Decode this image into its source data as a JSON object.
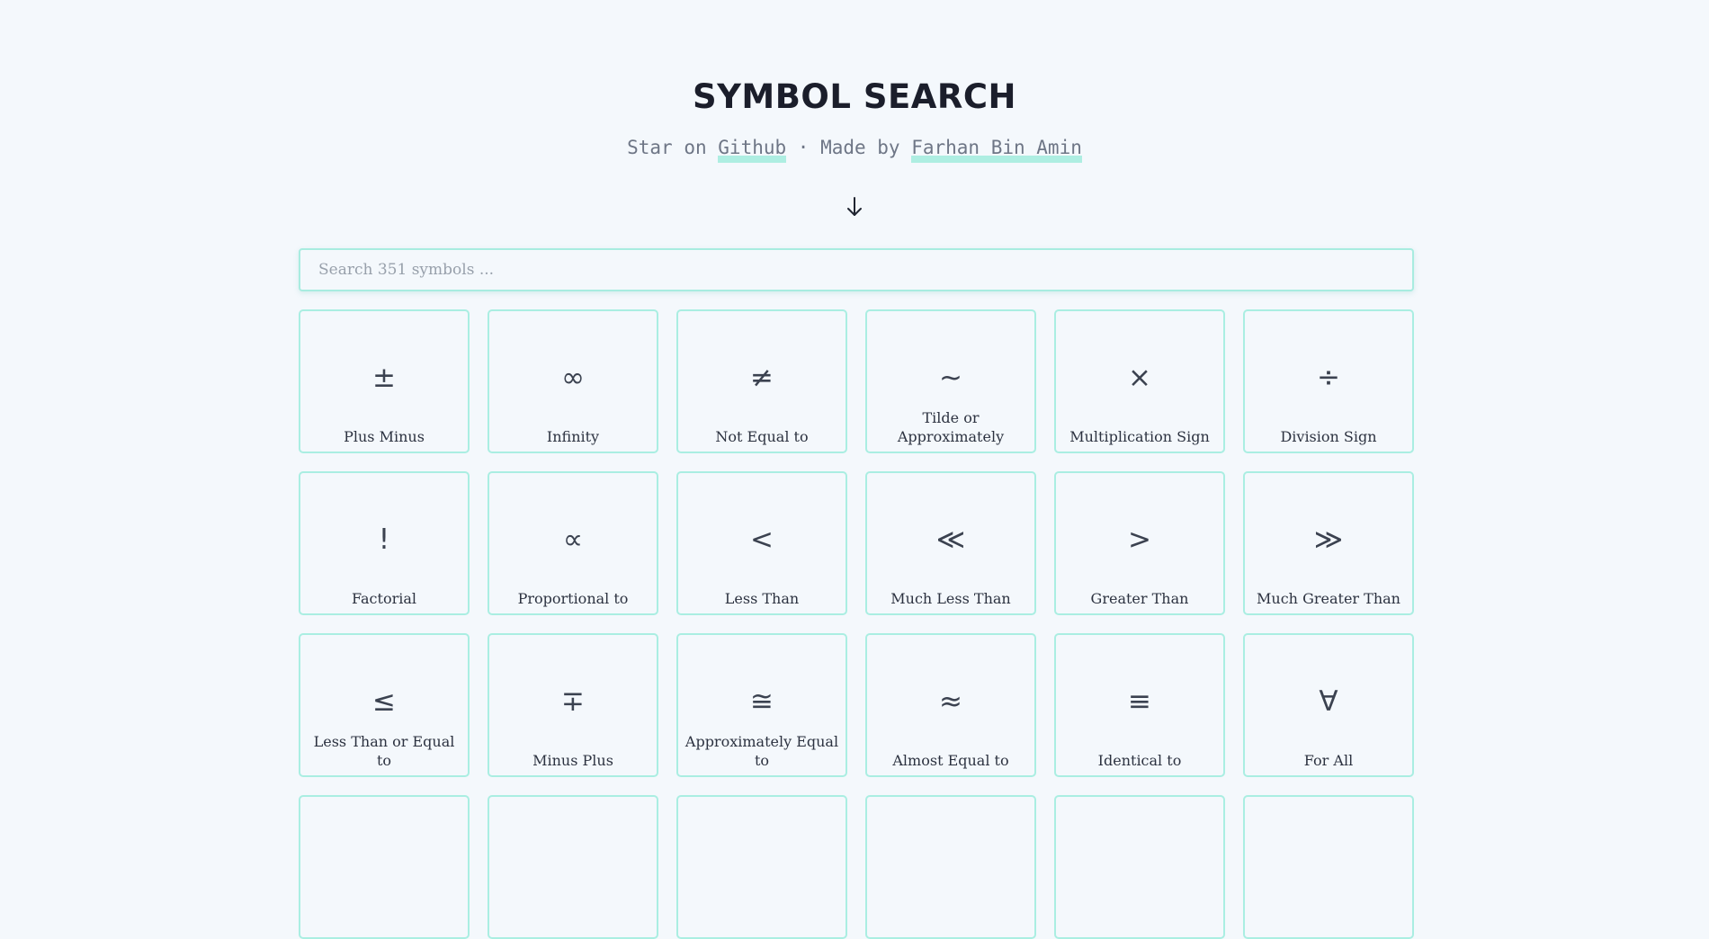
{
  "header": {
    "title": "SYMBOL SEARCH",
    "subtitle_prefix": "Star on ",
    "github_link": "Github",
    "separator": " · Made by ",
    "author_link": "Farhan Bin Amin"
  },
  "search": {
    "placeholder": "Search 351 symbols ...",
    "value": ""
  },
  "icons": {
    "scroll_arrow": "arrow-down-icon"
  },
  "colors": {
    "background": "#f4f8fc",
    "accent": "#aaeee2",
    "title": "#1b1e2b",
    "muted_text": "#6e7686"
  },
  "symbols": [
    {
      "symbol": "±",
      "name": "Plus Minus"
    },
    {
      "symbol": "∞",
      "name": "Infinity"
    },
    {
      "symbol": "≠",
      "name": "Not Equal to"
    },
    {
      "symbol": "~",
      "name": "Tilde or Approximately"
    },
    {
      "symbol": "×",
      "name": "Multiplication Sign"
    },
    {
      "symbol": "÷",
      "name": "Division Sign"
    },
    {
      "symbol": "!",
      "name": "Factorial"
    },
    {
      "symbol": "∝",
      "name": "Proportional to"
    },
    {
      "symbol": "<",
      "name": "Less Than"
    },
    {
      "symbol": "≪",
      "name": "Much Less Than"
    },
    {
      "symbol": ">",
      "name": "Greater Than"
    },
    {
      "symbol": "≫",
      "name": "Much Greater Than"
    },
    {
      "symbol": "≤",
      "name": "Less Than or Equal to"
    },
    {
      "symbol": "∓",
      "name": "Minus Plus"
    },
    {
      "symbol": "≅",
      "name": "Approximately Equal to"
    },
    {
      "symbol": "≈",
      "name": "Almost Equal to"
    },
    {
      "symbol": "≡",
      "name": "Identical to"
    },
    {
      "symbol": "∀",
      "name": "For All"
    },
    {
      "symbol": "",
      "name": ""
    },
    {
      "symbol": "",
      "name": ""
    },
    {
      "symbol": "",
      "name": ""
    },
    {
      "symbol": "",
      "name": ""
    },
    {
      "symbol": "",
      "name": ""
    },
    {
      "symbol": "",
      "name": ""
    }
  ]
}
